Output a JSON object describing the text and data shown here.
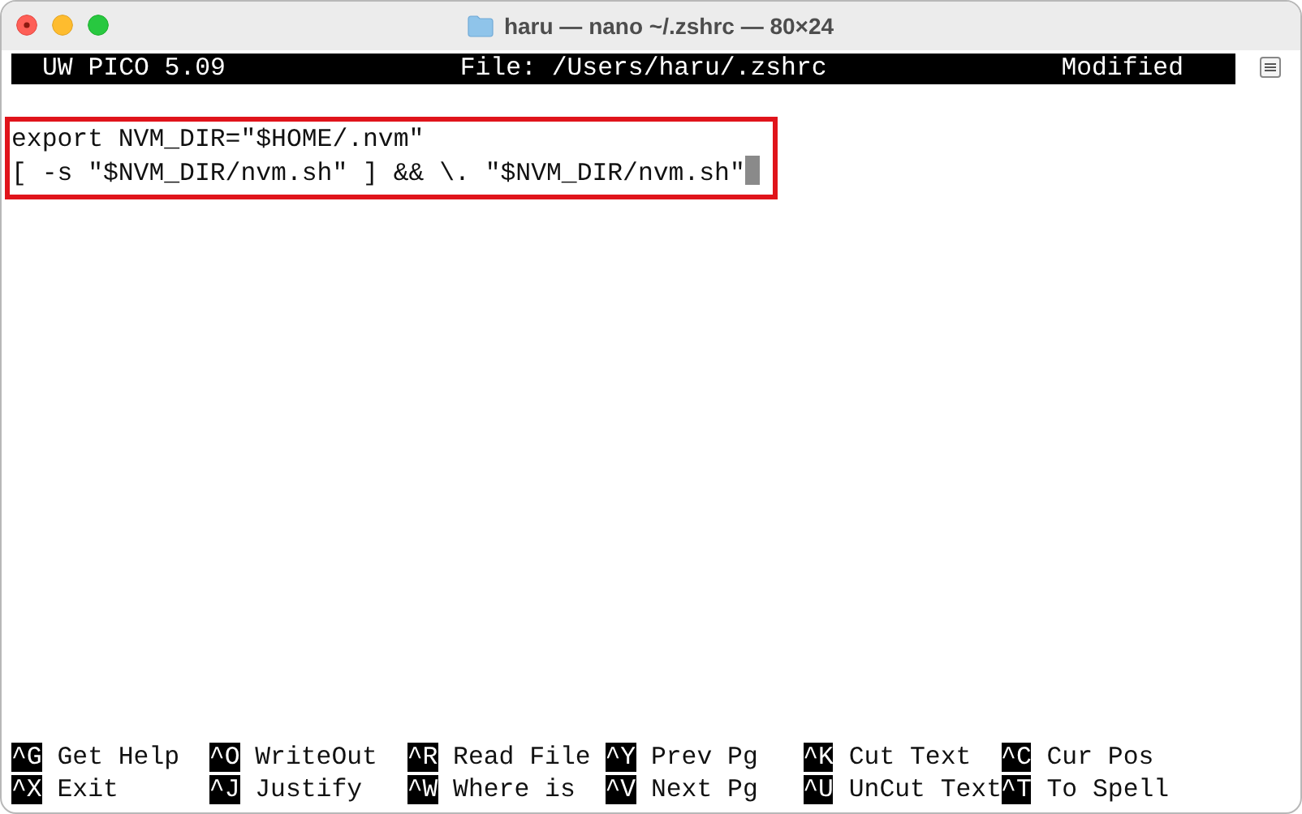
{
  "window": {
    "title": "haru — nano ~/.zshrc — 80×24"
  },
  "header": {
    "program": "UW PICO 5.09",
    "file": "File: /Users/haru/.zshrc",
    "status": "Modified"
  },
  "lines": [
    "export NVM_DIR=\"$HOME/.nvm\"",
    "[ -s \"$NVM_DIR/nvm.sh\" ] && \\. \"$NVM_DIR/nvm.sh\""
  ],
  "shortcuts": [
    [
      {
        "key": "^G",
        "label": "Get Help"
      },
      {
        "key": "^O",
        "label": "WriteOut"
      },
      {
        "key": "^R",
        "label": "Read File"
      },
      {
        "key": "^Y",
        "label": "Prev Pg"
      },
      {
        "key": "^K",
        "label": "Cut Text"
      },
      {
        "key": "^C",
        "label": "Cur Pos"
      }
    ],
    [
      {
        "key": "^X",
        "label": "Exit"
      },
      {
        "key": "^J",
        "label": "Justify"
      },
      {
        "key": "^W",
        "label": "Where is"
      },
      {
        "key": "^V",
        "label": "Next Pg"
      },
      {
        "key": "^U",
        "label": "UnCut Text"
      },
      {
        "key": "^T",
        "label": "To Spell"
      }
    ]
  ]
}
